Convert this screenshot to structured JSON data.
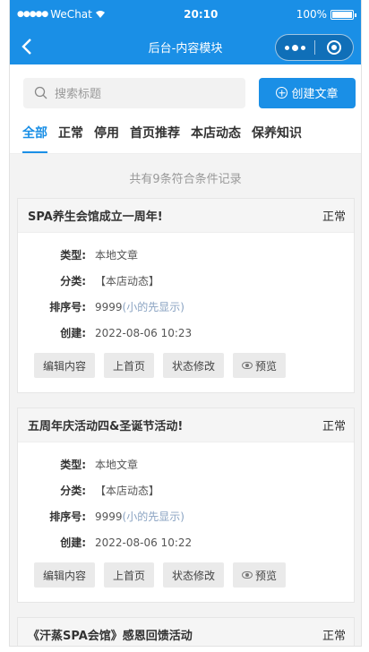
{
  "status_bar": {
    "carrier": "WeChat",
    "time": "20:10",
    "battery": "100%"
  },
  "nav": {
    "title": "后台-内容模块"
  },
  "search": {
    "placeholder": "搜索标题"
  },
  "create_button": {
    "label": "创建文章"
  },
  "tabs": [
    {
      "label": "全部",
      "active": true
    },
    {
      "label": "正常"
    },
    {
      "label": "停用"
    },
    {
      "label": "首页推荐"
    },
    {
      "label": "本店动态"
    },
    {
      "label": "保养知识"
    }
  ],
  "count_text": "共有9条符合条件记录",
  "field_labels": {
    "type": "类型:",
    "category": "分类:",
    "sort": "排序号:",
    "created": "创建:"
  },
  "sort_hint": "(小的先显示)",
  "actions": {
    "edit": "编辑内容",
    "home": "上首页",
    "status": "状态修改",
    "preview": "预览"
  },
  "articles": [
    {
      "title": "SPA养生会馆成立一周年!",
      "status": "正常",
      "type": "本地文章",
      "category": "【本店动态】",
      "sort": "9999",
      "created": "2022-08-06 10:23"
    },
    {
      "title": "五周年庆活动四&圣诞节活动!",
      "status": "正常",
      "type": "本地文章",
      "category": "【本店动态】",
      "sort": "9999",
      "created": "2022-08-06 10:22"
    },
    {
      "title": "《汗蒸SPA会馆》感恩回馈活动",
      "status": "正常"
    }
  ],
  "colors": {
    "primary": "#1a8fe6",
    "hint": "#8aa3c2"
  }
}
